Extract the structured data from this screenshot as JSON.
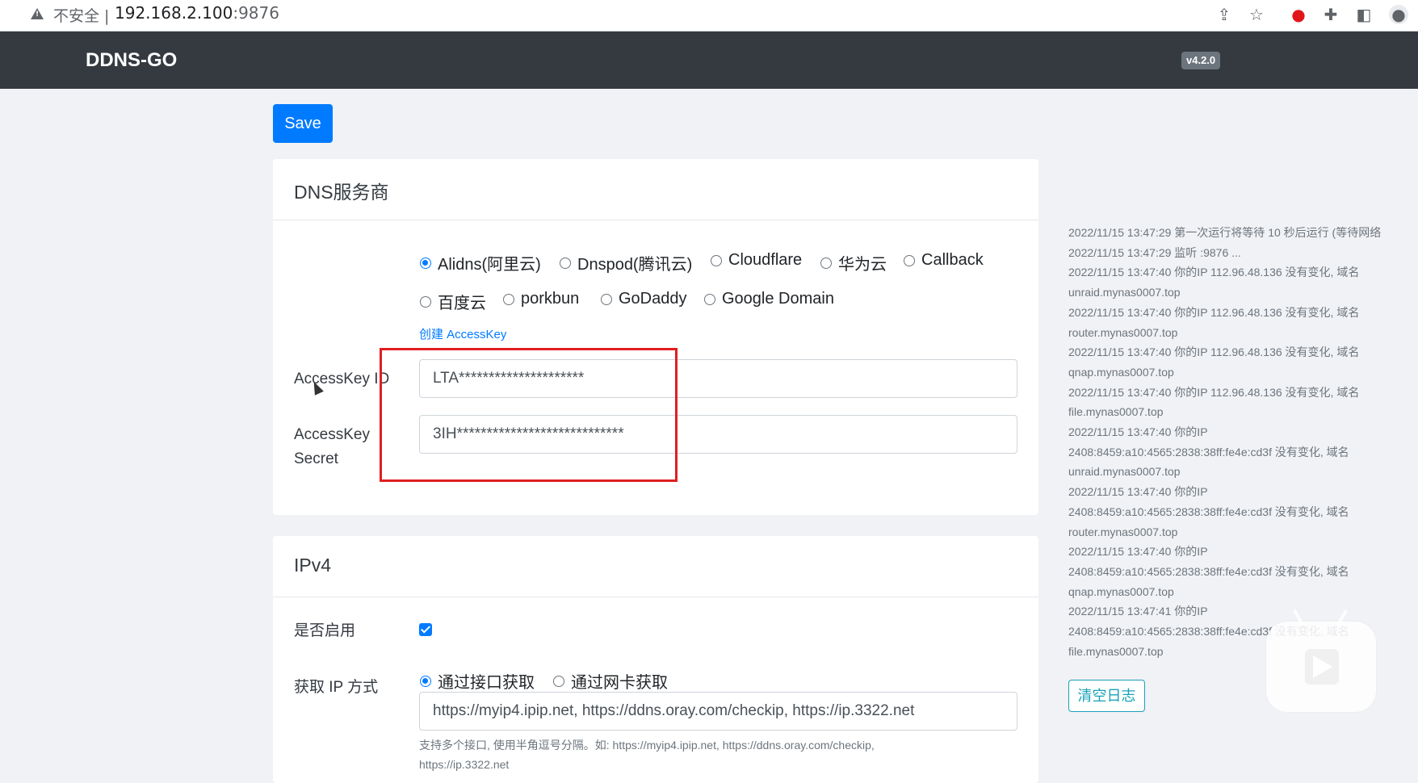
{
  "browser": {
    "security_label": "不安全",
    "url_host": "192.168.2.100",
    "url_port": ":9876",
    "icons": [
      "share-icon",
      "star-icon",
      "opera-icon",
      "extensions-icon",
      "sidepanel-icon",
      "profile-icon"
    ]
  },
  "navbar": {
    "brand": "DDNS-GO",
    "version": "v4.2.0"
  },
  "toolbar": {
    "save_label": "Save"
  },
  "dns_card": {
    "title": "DNS服务商",
    "providers_row1": [
      {
        "label": "Alidns(阿里云)",
        "checked": true
      },
      {
        "label": "Dnspod(腾讯云)",
        "checked": false
      },
      {
        "label": "Cloudflare",
        "checked": false
      },
      {
        "label": "华为云",
        "checked": false
      },
      {
        "label": "Callback",
        "checked": false
      }
    ],
    "providers_row2": [
      {
        "label": "百度云",
        "checked": false
      },
      {
        "label": "porkbun",
        "checked": false
      },
      {
        "label": "GoDaddy",
        "checked": false
      },
      {
        "label": "Google Domain",
        "checked": false
      }
    ],
    "create_link": "创建 AccessKey",
    "access_key_id_label": "AccessKey ID",
    "access_key_id_value": "LTA*********************",
    "access_key_secret_label_line1": "AccessKey",
    "access_key_secret_label_line2": "Secret",
    "access_key_secret_value": "3IH****************************"
  },
  "ipv4_card": {
    "title": "IPv4",
    "enable_label": "是否启用",
    "enabled": true,
    "method_label": "获取 IP 方式",
    "method_options": [
      {
        "label": "通过接口获取",
        "checked": true
      },
      {
        "label": "通过网卡获取",
        "checked": false
      }
    ],
    "url_value": "https://myip4.ipip.net, https://ddns.oray.com/checkip, https://ip.3322.net",
    "help_line1": "支持多个接口, 使用半角逗号分隔。如:   https://myip4.ipip.net, https://ddns.oray.com/checkip,",
    "help_line2": "https://ip.3322.net"
  },
  "log": {
    "lines": [
      "2022/11/15 13:47:29 第一次运行将等待 10 秒后运行 (等待网络",
      "2022/11/15 13:47:29 监听 :9876 ...",
      "2022/11/15 13:47:40 你的IP 112.96.48.136 没有变化, 域名",
      "unraid.mynas0007.top",
      "2022/11/15 13:47:40 你的IP 112.96.48.136 没有变化, 域名",
      "router.mynas0007.top",
      "2022/11/15 13:47:40 你的IP 112.96.48.136 没有变化, 域名",
      "qnap.mynas0007.top",
      "2022/11/15 13:47:40 你的IP 112.96.48.136 没有变化, 域名",
      "file.mynas0007.top",
      "2022/11/15 13:47:40 你的IP",
      "2408:8459:a10:4565:2838:38ff:fe4e:cd3f 没有变化, 域名",
      "unraid.mynas0007.top",
      "2022/11/15 13:47:40 你的IP",
      "2408:8459:a10:4565:2838:38ff:fe4e:cd3f 没有变化, 域名",
      "router.mynas0007.top",
      "2022/11/15 13:47:40 你的IP",
      "2408:8459:a10:4565:2838:38ff:fe4e:cd3f 没有变化, 域名",
      "qnap.mynas0007.top",
      "2022/11/15 13:47:41 你的IP",
      "2408:8459:a10:4565:2838:38ff:fe4e:cd3f 没有变化, 域名",
      "file.mynas0007.top"
    ],
    "clear_label": "清空日志"
  },
  "colors": {
    "primary": "#007bff",
    "navbar": "#343a40",
    "info": "#17a2b8",
    "highlight": "#e01e1e"
  }
}
